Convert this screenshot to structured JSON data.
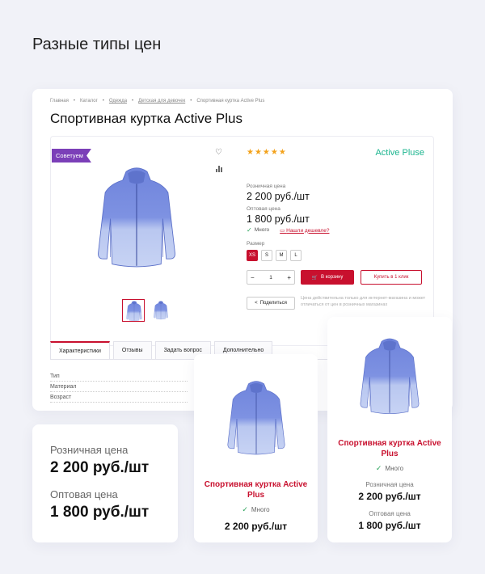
{
  "heading": "Разные типы цен",
  "breadcrumb": [
    "Главная",
    "Каталог",
    "Одежда",
    "Детская для девочек",
    "Спортивная куртка Active Plus"
  ],
  "product": {
    "title": "Спортивная куртка Active Plus",
    "badge": "Советуем",
    "stars": "★★★★★",
    "brand": "Active Pluse",
    "retail_label": "Розничная цена",
    "retail_price": "2 200 руб./шт",
    "wholesale_label": "Оптовая цена",
    "wholesale_price": "1 800 руб./шт",
    "stock": "Много",
    "cheaper_link": "Нашли дешевле?",
    "size_label": "Размер",
    "sizes": [
      "XS",
      "S",
      "M",
      "L"
    ],
    "qty_minus": "−",
    "qty_value": "1",
    "qty_plus": "+",
    "cart_button": "В корзину",
    "one_click_button": "Купить в 1 клик",
    "share_button": "Поделиться",
    "note": "Цена действительна только для интернет-магазина и может отличаться от цен в розничных магазинах",
    "jacket_color": "#7b8fe0"
  },
  "tabs": [
    "Характеристики",
    "Отзывы",
    "Задать вопрос",
    "Дополнительно"
  ],
  "properties": [
    "Тип",
    "Материал",
    "Возраст"
  ],
  "price_card": {
    "retail_label": "Розничная цена",
    "retail_price": "2 200 руб./шт",
    "wholesale_label": "Оптовая цена",
    "wholesale_price": "1 800 руб./шт"
  },
  "card1": {
    "name": "Спортивная куртка Active Plus",
    "stock": "Много",
    "price": "2 200 руб./шт"
  },
  "card2": {
    "name": "Спортивная куртка Active Plus",
    "stock": "Много",
    "retail_label": "Розничная цена",
    "retail_price": "2 200 руб./шт",
    "wholesale_label": "Оптовая цена",
    "wholesale_price": "1 800 руб./шт"
  },
  "colors": {
    "accent": "#c8102e",
    "badge": "#7b3fb8",
    "brand": "#1cb58f",
    "stars": "#f3a21b"
  }
}
